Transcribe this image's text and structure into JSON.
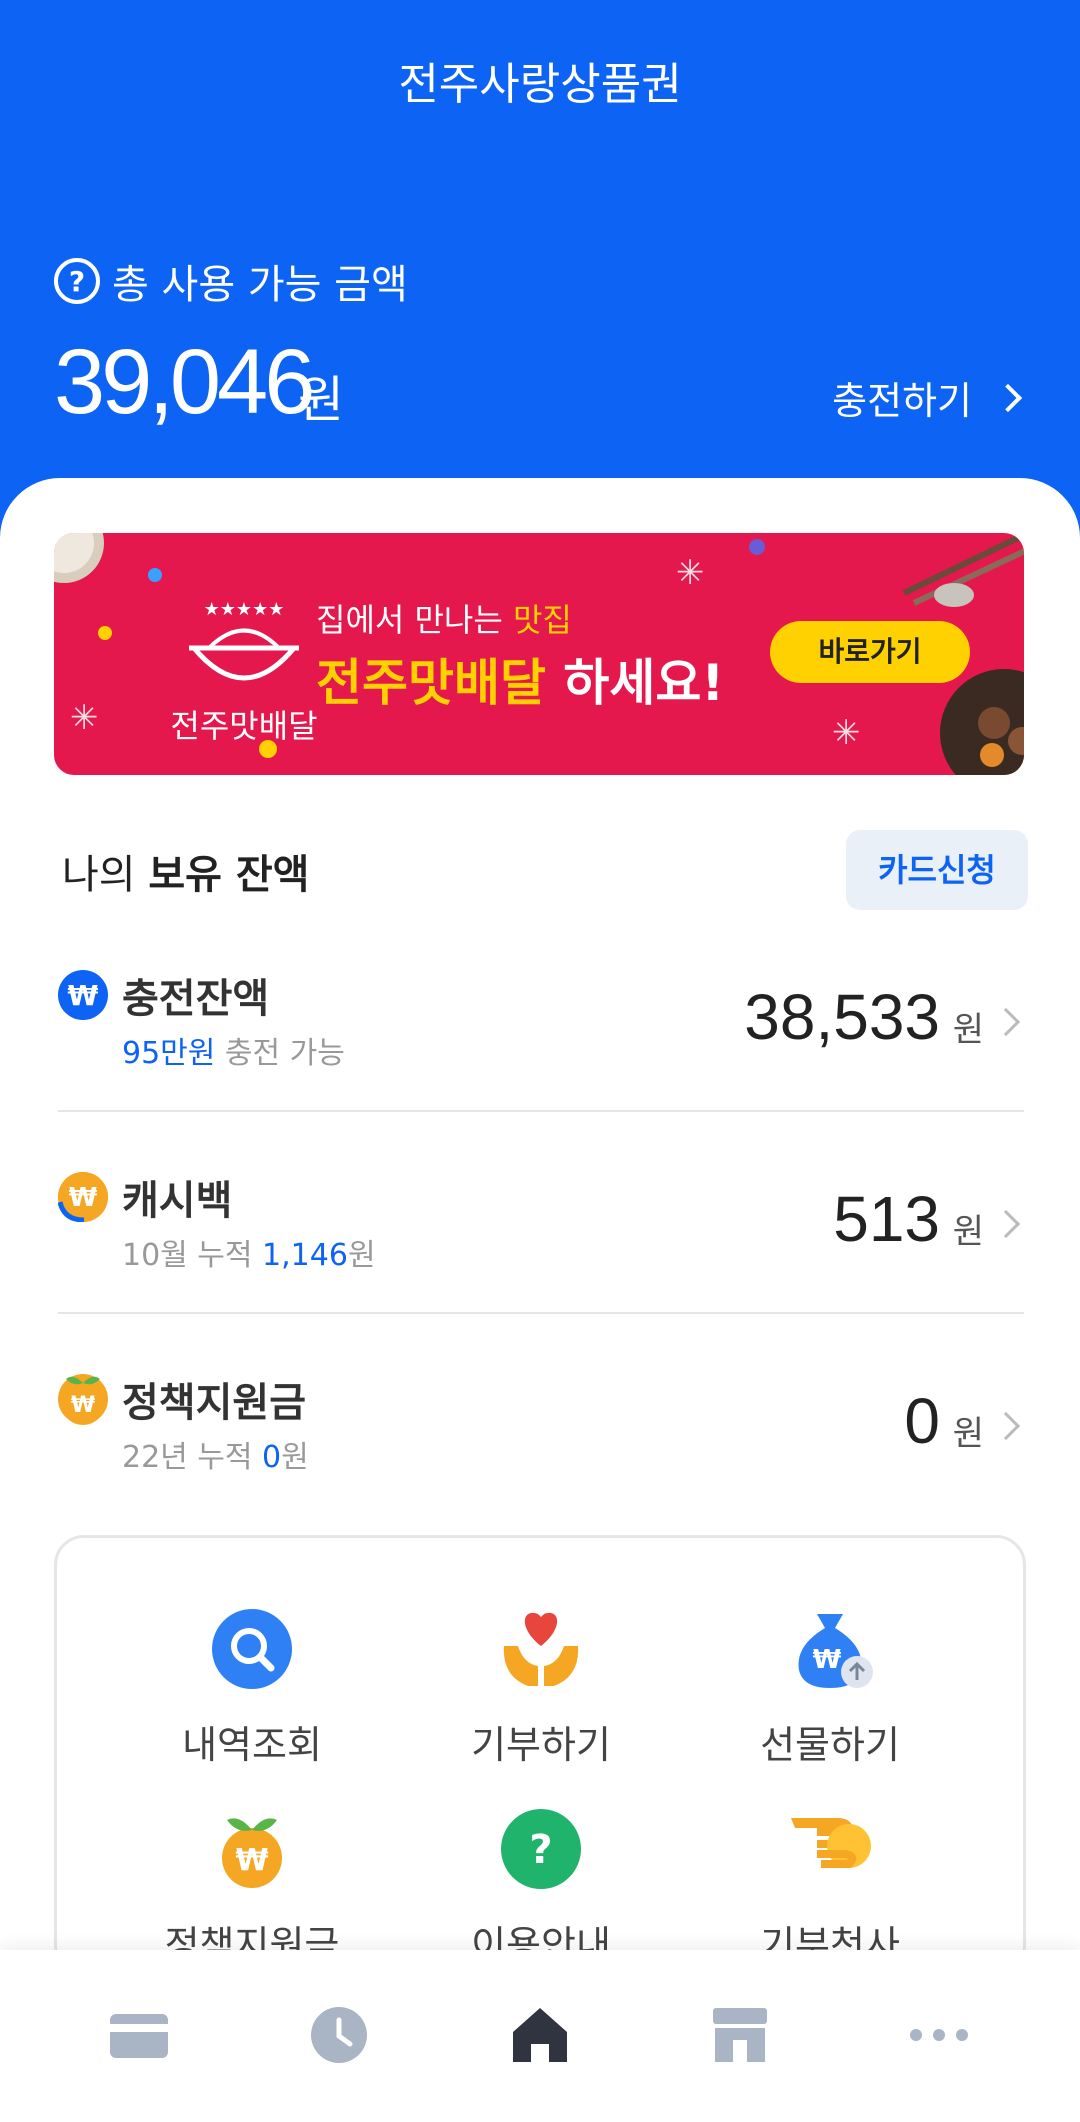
{
  "header": {
    "app_title": "전주사랑상품권",
    "total_label": "총 사용 가능 금액",
    "total_amount": "39,046",
    "total_unit": "원",
    "charge_link": "충전하기",
    "bg_color": "#0d63f3"
  },
  "banner": {
    "logo_text": "전주맛배달",
    "subtitle_prefix": "집에서 만나는 ",
    "subtitle_highlight": "맛집",
    "title_highlight": "전주맛배달",
    "title_rest": " 하세요!",
    "button_label": "바로가기",
    "bg_color": "#e4184c",
    "accent_color": "#ffd100"
  },
  "balance": {
    "heading_prefix": "나의 ",
    "heading_bold": "보유 잔액",
    "card_apply_label": "카드신청",
    "items": [
      {
        "icon": "won-coin-icon",
        "name": "충전잔액",
        "sub_highlight": "95만원",
        "sub_rest": " 충전 가능",
        "amount": "38,533",
        "unit": "원"
      },
      {
        "icon": "cashback-coin-icon",
        "name": "캐시백",
        "sub_prefix": "10월 누적 ",
        "sub_highlight": "1,146",
        "sub_suffix": "원",
        "amount": "513",
        "unit": "원"
      },
      {
        "icon": "sprout-coin-icon",
        "name": "정책지원금",
        "sub_prefix": "22년 누적 ",
        "sub_highlight": "0",
        "sub_suffix": "원",
        "amount": "0",
        "unit": "원"
      }
    ]
  },
  "menu": {
    "items": [
      {
        "label": "내역조회",
        "icon": "search-icon"
      },
      {
        "label": "기부하기",
        "icon": "heart-hands-icon"
      },
      {
        "label": "선물하기",
        "icon": "money-bag-icon"
      },
      {
        "label": "정책지원금",
        "icon": "sprout-coin-icon"
      },
      {
        "label": "이용안내",
        "icon": "question-icon"
      },
      {
        "label": "기부천사",
        "icon": "hand-coin-icon"
      }
    ]
  },
  "bottom_nav": {
    "items": [
      {
        "icon": "card-icon"
      },
      {
        "icon": "clock-icon"
      },
      {
        "icon": "home-icon",
        "active": true
      },
      {
        "icon": "store-icon"
      },
      {
        "icon": "more-icon"
      }
    ]
  }
}
